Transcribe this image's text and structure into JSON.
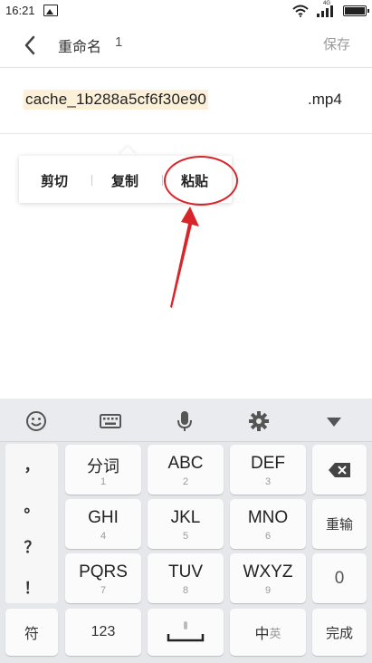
{
  "status_bar": {
    "time": "16:21",
    "image_icon": "image-icon",
    "wifi_icon": "wifi-icon",
    "signal_label": "4G",
    "signal_icon": "signal-icon",
    "battery_icon": "battery-icon"
  },
  "header": {
    "back_icon": "chevron-left-icon",
    "title": "重命名",
    "count": "1",
    "save_label": "保存"
  },
  "filename": {
    "name": "cache_1b288a5cf6f30e90",
    "extension": ".mp4"
  },
  "context_menu": {
    "items": [
      "剪切",
      "复制",
      "粘贴"
    ]
  },
  "keyboard": {
    "toolbar_icons": [
      "emoji-icon",
      "keyboard-icon",
      "microphone-icon",
      "gear-icon",
      "collapse-arrow-icon"
    ],
    "punctuation": [
      "，",
      "。",
      "？",
      "！"
    ],
    "keys": [
      {
        "main": "分词",
        "sub": "1"
      },
      {
        "main": "ABC",
        "sub": "2"
      },
      {
        "main": "DEF",
        "sub": "3"
      },
      {
        "main": "GHI",
        "sub": "4"
      },
      {
        "main": "JKL",
        "sub": "5"
      },
      {
        "main": "MNO",
        "sub": "6"
      },
      {
        "main": "PQRS",
        "sub": "7"
      },
      {
        "main": "TUV",
        "sub": "8"
      },
      {
        "main": "WXYZ",
        "sub": "9"
      }
    ],
    "right_keys": {
      "backspace_icon": "backspace-icon",
      "retype": "重输",
      "zero": "0"
    },
    "bottom_row": {
      "symbols": "符",
      "numbers": "123",
      "space_icon": "space-bar-icon",
      "chinese": "中",
      "chinese_suffix": "英",
      "done": "完成"
    }
  },
  "colors": {
    "highlight": "#fdf0d9",
    "annotation_red": "#d9252a",
    "keyboard_bg": "#e5e7ea"
  }
}
